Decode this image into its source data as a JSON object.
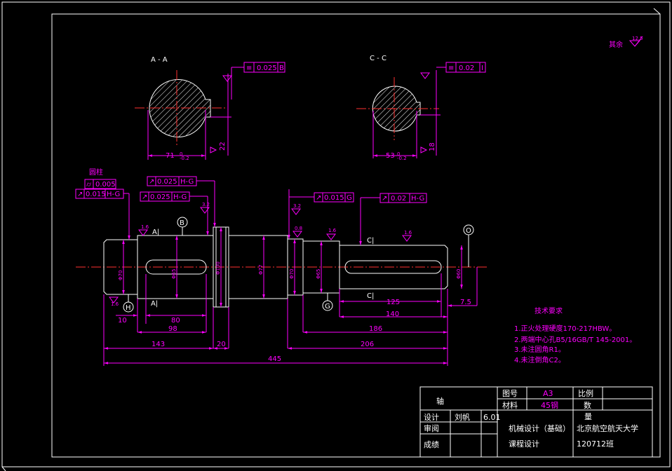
{
  "section_labels": {
    "aa": "A - A",
    "cc": "C - C",
    "a1_top": "A|",
    "a1_bot": "A|",
    "c1_top": "C|",
    "c1_bot": "C|"
  },
  "datums": {
    "b": "B",
    "h": "H",
    "g": "G",
    "o": "O"
  },
  "tolerances": {
    "aa_sym": "0.025",
    "aa_sym_ref": "B",
    "cc_sym": "0.02",
    "cc_sym_ref": "I",
    "runout_top1": "0.025",
    "runout_top1_ref": "H-G",
    "cyl_val": "0.005",
    "runout_h1": "0.015",
    "runout_h1_ref": "H-G",
    "runout_h2": "0.025",
    "runout_h2_ref": "H-G",
    "runout_mid": "0.015",
    "runout_mid_ref": "G",
    "runout_right": "0.02",
    "runout_right_ref": "H-G",
    "note_left": "圆柱"
  },
  "section_dims": {
    "aa_width": "71",
    "aa_key": "22",
    "cc_width": "53",
    "cc_key": "18",
    "aa_rough": "3.2",
    "cc_rough": "3.2"
  },
  "dims": {
    "d10": "10",
    "d80": "80",
    "d98": "98",
    "d143": "143",
    "d20": "20",
    "d206": "206",
    "d445": "445",
    "d125": "125",
    "d140": "140",
    "d186": "186",
    "d75": "7.5",
    "phi100": "Φ100",
    "phi77": "Φ77",
    "phi70": "Φ70",
    "phi65": "Φ65",
    "phi60": "Φ60"
  },
  "roughness": {
    "other": "其余",
    "other_val": "12.5",
    "r1": "1.6",
    "r2": "1.6",
    "r3": "0.8",
    "r4": "1.6",
    "r5": "1.6",
    "r6": "3.2",
    "r7": "3.2",
    "r8": "0.8"
  },
  "tech_req": {
    "title": "技术要求",
    "items": [
      "1.正火处理硬度170-217HBW。",
      "2.两端中心孔B5/16GB/T 145-2001。",
      "3.未注圆角R1。",
      "4.未注倒角C2。"
    ]
  },
  "title_block": {
    "part_name": "轴",
    "drawing_no_label": "图号",
    "drawing_no": "A3",
    "scale_label": "比例",
    "material_label": "材料",
    "material": "45钢",
    "qty_label": "数",
    "qty_label2": "量",
    "design_label": "设计",
    "designer": "刘帆",
    "date": "6.01",
    "review_label": "审阅",
    "grade_label": "成绩",
    "course1": "机械设计（基础）",
    "course2": "课程设计",
    "school": "北京航空航天大学",
    "class": "120712班"
  },
  "colors": {
    "background": "#000000",
    "geometry": "#ffffff",
    "annotation": "#ff00ff",
    "centerline": "#ff3030"
  }
}
